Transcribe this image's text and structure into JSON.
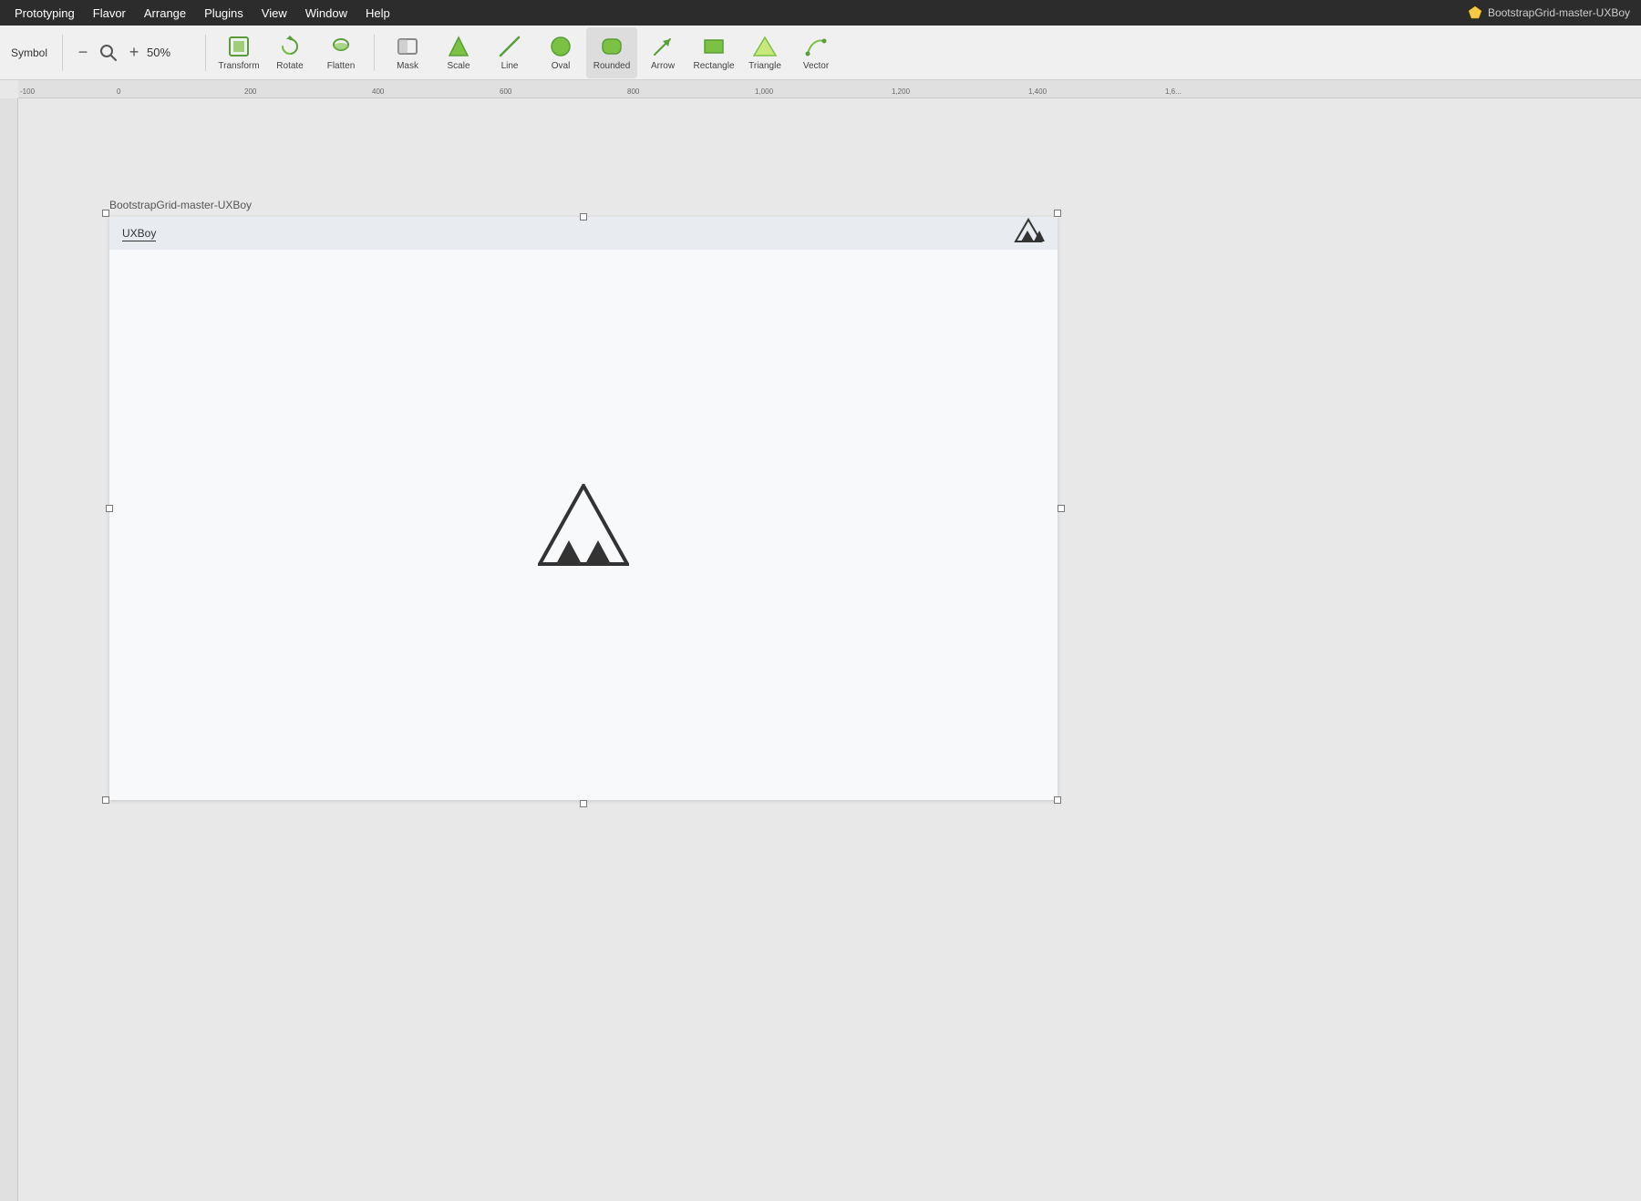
{
  "menubar": {
    "items": [
      "Prototyping",
      "Flavor",
      "Arrange",
      "Plugins",
      "View",
      "Window",
      "Help"
    ]
  },
  "toolbar": {
    "symbol_label": "Symbol",
    "zoom_minus": "−",
    "zoom_plus": "+",
    "zoom_level": "50%",
    "tools": [
      {
        "id": "transform",
        "label": "Transform",
        "icon": "transform"
      },
      {
        "id": "rotate",
        "label": "Rotate",
        "icon": "rotate"
      },
      {
        "id": "flatten",
        "label": "Flatten",
        "icon": "flatten"
      },
      {
        "id": "mask",
        "label": "Mask",
        "icon": "mask"
      },
      {
        "id": "scale",
        "label": "Scale",
        "icon": "scale"
      },
      {
        "id": "line",
        "label": "Line",
        "icon": "line"
      },
      {
        "id": "oval",
        "label": "Oval",
        "icon": "oval"
      },
      {
        "id": "rounded",
        "label": "Rounded",
        "icon": "rounded"
      },
      {
        "id": "arrow",
        "label": "Arrow",
        "icon": "arrow"
      },
      {
        "id": "rectangle",
        "label": "Rectangle",
        "icon": "rectangle"
      },
      {
        "id": "triangle",
        "label": "Triangle",
        "icon": "triangle"
      },
      {
        "id": "vector",
        "label": "Vector",
        "icon": "vector"
      }
    ]
  },
  "file": {
    "name": "BootstrapGrid-master-UXBoy"
  },
  "artboard": {
    "label": "BootstrapGrid-master-UXBoy",
    "inner_title": "UXBoy"
  },
  "ruler": {
    "marks_h": [
      -100,
      0,
      200,
      400,
      600,
      800,
      "1,000",
      "1,200",
      "1,400",
      "1,6"
    ],
    "canvas_label": "0"
  }
}
